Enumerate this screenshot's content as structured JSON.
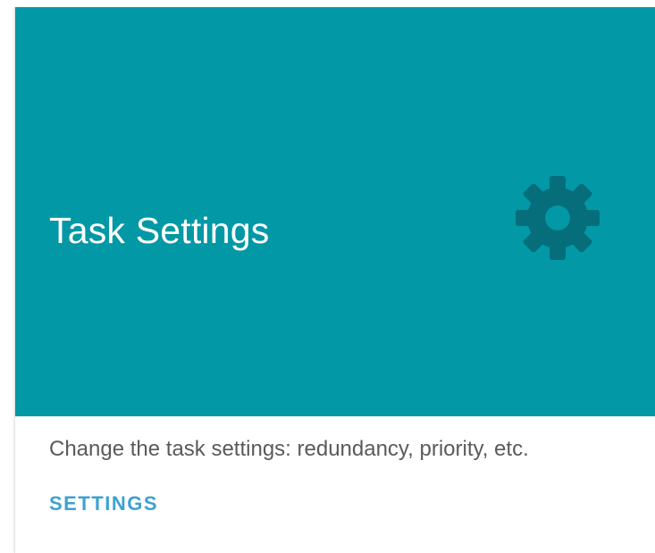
{
  "card": {
    "title": "Task Settings",
    "icon": "gear-icon",
    "description": "Change the task settings: redundancy, priority, etc.",
    "action_label": "SETTINGS"
  },
  "colors": {
    "header_background": "#0298a6",
    "icon_color": "#066d7a",
    "title_text": "#ffffff",
    "description_text": "#5a5a5a",
    "action_text": "#3ea2d0"
  }
}
